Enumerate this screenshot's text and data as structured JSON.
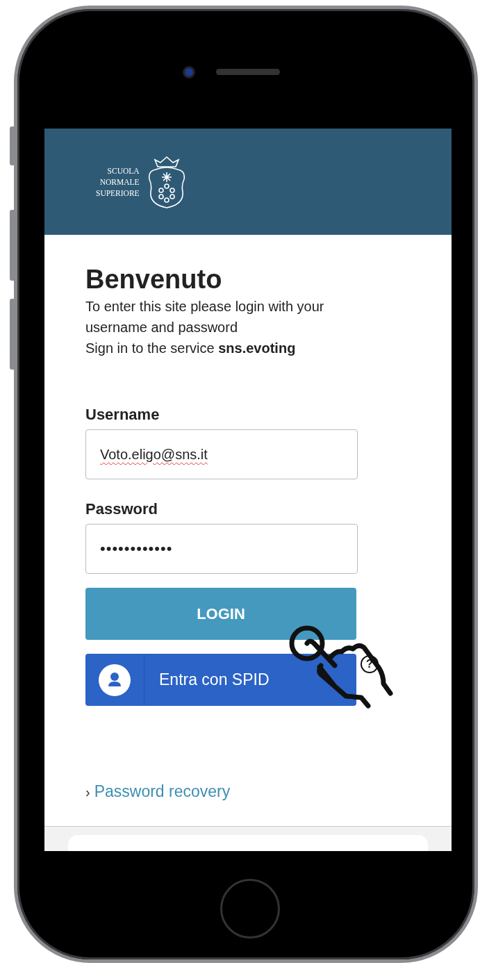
{
  "header": {
    "logo_lines": [
      "SCUOLA",
      "NORMALE",
      "SUPERIORE"
    ]
  },
  "title": "Benvenuto",
  "intro": [
    "To enter this site please login with your username and password",
    "Sign in to the service **sns.evoting**"
  ],
  "fields": [
    {
      "label": "Username",
      "value": "Voto.eligo@sns.it",
      "spellcheck_error": true
    },
    {
      "label": "Password",
      "value": "••••••••••••",
      "spellcheck_error": false
    }
  ],
  "buttons": [
    {
      "kind": "primary",
      "label": "LOGIN"
    },
    {
      "kind": "spid",
      "label": "Entra con SPID"
    }
  ],
  "help_mark": "?",
  "link": {
    "prefix": "›",
    "label": "Password recovery"
  }
}
